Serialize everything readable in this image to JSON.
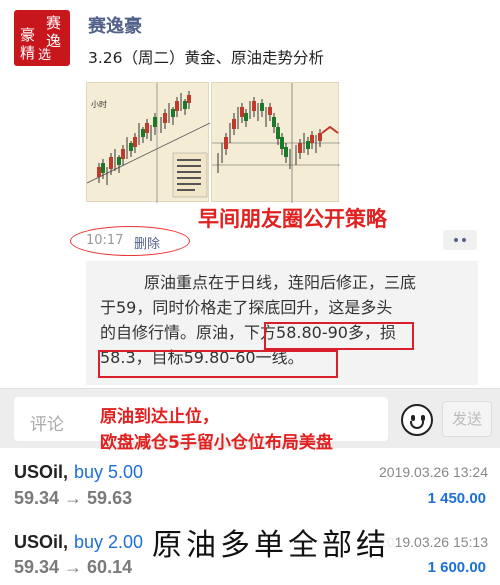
{
  "author": {
    "name": "赛逸豪",
    "avatar_text": [
      "赛",
      "逸",
      "豪",
      "精",
      "选"
    ]
  },
  "post": {
    "title": "3.26（周二）黄金、原油走势分析",
    "time": "10:17",
    "delete_label": "删除"
  },
  "images": [
    {
      "label_tl": "小时",
      "label_b": ""
    },
    {
      "label_tl": "",
      "label_b": ""
    }
  ],
  "strategy_caption": "早间朋友圈公开策略",
  "comment": {
    "line1": "原油重点在于日线，连阳后修正，三底",
    "line2": "于59，同时价格走了探底回升，这是多头",
    "line3_a": "的自修行情。原油，",
    "line3_b": "下方58.80-90多",
    "line3_c": "，损",
    "line4_a": "58.3，目标59.80-60一线。"
  },
  "input": {
    "placeholder": "评论",
    "send_label": "发送"
  },
  "alert": {
    "line1": "原油到达止位，",
    "line2": "欧盘减仓5手留小仓位布局美盘"
  },
  "trades": [
    {
      "symbol": "USOil,",
      "side": "buy 5.00",
      "prices": "59.34 → 59.63",
      "time": "2019.03.26 13:24",
      "profit": "1 450.00"
    },
    {
      "symbol": "USOil,",
      "side": "buy 2.00",
      "prices": "59.34 → 60.14",
      "time": "2019.03.26 15:13",
      "profit": "1 600.00"
    }
  ],
  "closed_note": "原油多单全部结",
  "colors": {
    "red": "#e12020",
    "blue": "#1e6fd9",
    "name": "#52618a"
  }
}
